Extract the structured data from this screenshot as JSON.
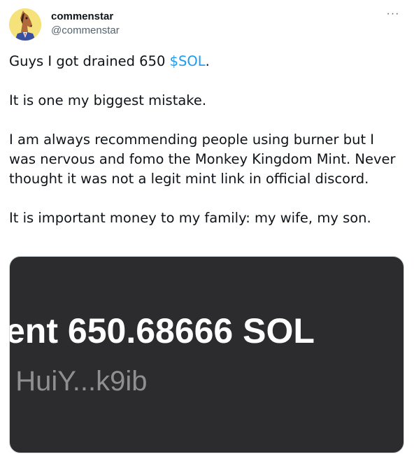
{
  "user": {
    "display_name": "commenstar",
    "handle": "@commenstar",
    "avatar_icon": "horse-avatar-icon"
  },
  "more_label": "···",
  "tweet": {
    "line1_text": "Guys I got drained 650 ",
    "line1_cashtag": "$SOL",
    "line1_end": ".",
    "p2": "It is one my biggest mistake.",
    "p3": "I am always recommending people using burner but I was nervous and fomo the Monkey Kingdom Mint. Never thought it was not a legit mint link in official discord.",
    "p4": "It is important money to my family: my wife, my son."
  },
  "media": {
    "amount_line": "ent 650.68666 SOL",
    "address_line": ": HuiY...k9ib"
  },
  "colors": {
    "cashtag": "#1d9bf0",
    "media_bg": "#2c2c2e",
    "avatar_bg": "#f6e27a"
  }
}
